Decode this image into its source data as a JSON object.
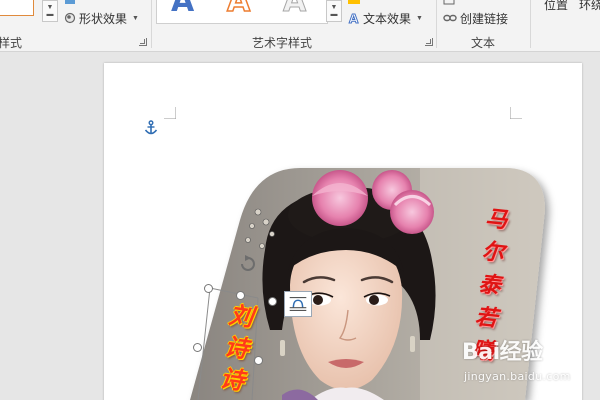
{
  "ribbon": {
    "shape_styles": {
      "group_label_partial": "样式",
      "shape_effects_label": "形状效果"
    },
    "wordart_styles": {
      "group_label": "艺术字样式",
      "gallery_letters": [
        "A",
        "A",
        "A"
      ],
      "text_effects_label": "文本效果"
    },
    "text": {
      "group_label": "文本",
      "create_link_label": "创建链接"
    },
    "arrange": {
      "position_label": "位置",
      "wrap_partial_label": "环绕"
    }
  },
  "document": {
    "actor_name": [
      "刘",
      "诗",
      "诗"
    ],
    "role_name": [
      "马",
      "尔",
      "泰",
      "若",
      "曦"
    ],
    "watermark": {
      "logo": "Bai经验",
      "domain": "jingyan.baidu.com"
    }
  },
  "colors": {
    "ribbon_bg": "#f3f3f3",
    "workspace_bg": "#e6e6e6",
    "wordart_fill": "#4472c4",
    "wordart_orange": "#ed7d31",
    "actor_text": "#ff3a1a",
    "role_text": "#e01414"
  },
  "icons": [
    "shape-fill-icon",
    "shape-effects-icon",
    "text-effects-icon",
    "link-icon",
    "anchor-icon",
    "rotate-icon",
    "layout-options-icon",
    "dialog-launcher-icon"
  ]
}
